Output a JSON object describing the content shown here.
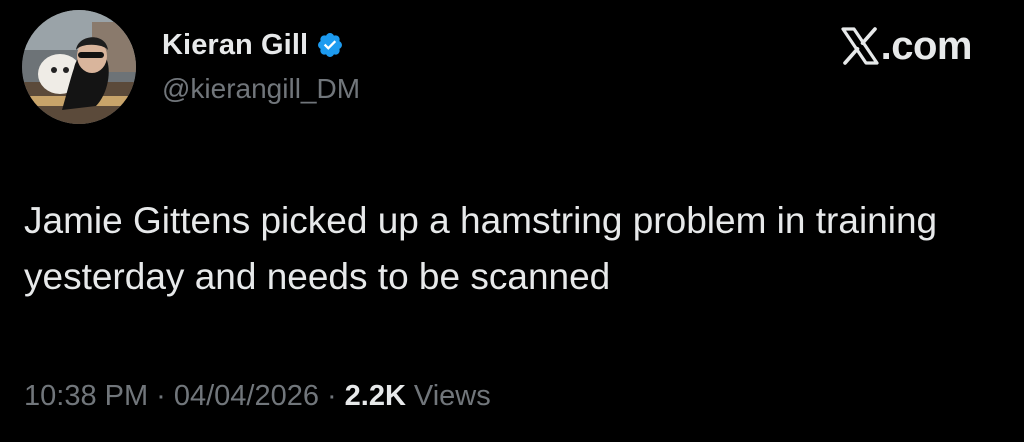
{
  "author": {
    "display_name": "Kieran Gill",
    "handle": "@kierangill_DM",
    "verified": true,
    "avatar_icon": "profile-photo"
  },
  "brand": {
    "icon": "x-logo-icon",
    "text": ".com"
  },
  "tweet": {
    "text": "Jamie Gittens picked up a hamstring problem in training yesterday and needs to be scanned"
  },
  "meta": {
    "time": "10:38 PM",
    "separator": "·",
    "date": "04/04/2026",
    "views_count": "2.2K",
    "views_label": "Views"
  },
  "colors": {
    "background": "#000000",
    "primary_text": "#e7e9ea",
    "secondary_text": "#71767b",
    "verified_badge": "#1d9bf0"
  }
}
